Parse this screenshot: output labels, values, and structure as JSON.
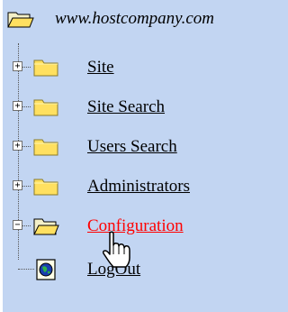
{
  "root": {
    "label": "www.hostcompany.com",
    "icon": "open-folder-icon"
  },
  "items": [
    {
      "label": "Site",
      "expander": "+",
      "icon": "folder-icon",
      "active": false
    },
    {
      "label": "Site Search",
      "expander": "+",
      "icon": "folder-icon",
      "active": false
    },
    {
      "label": "Users Search",
      "expander": "+",
      "icon": "folder-icon",
      "active": false
    },
    {
      "label": "Administrators",
      "expander": "+",
      "icon": "folder-icon",
      "active": false
    },
    {
      "label": "Configuration",
      "expander": "−",
      "icon": "open-folder-icon",
      "active": true
    },
    {
      "label": "LogOut",
      "icon": "globe-page-icon",
      "active": false
    }
  ],
  "colors": {
    "background": "#c2d5f2",
    "link": "#000000",
    "active_link": "#ff0000",
    "folder": "#ffe060"
  }
}
